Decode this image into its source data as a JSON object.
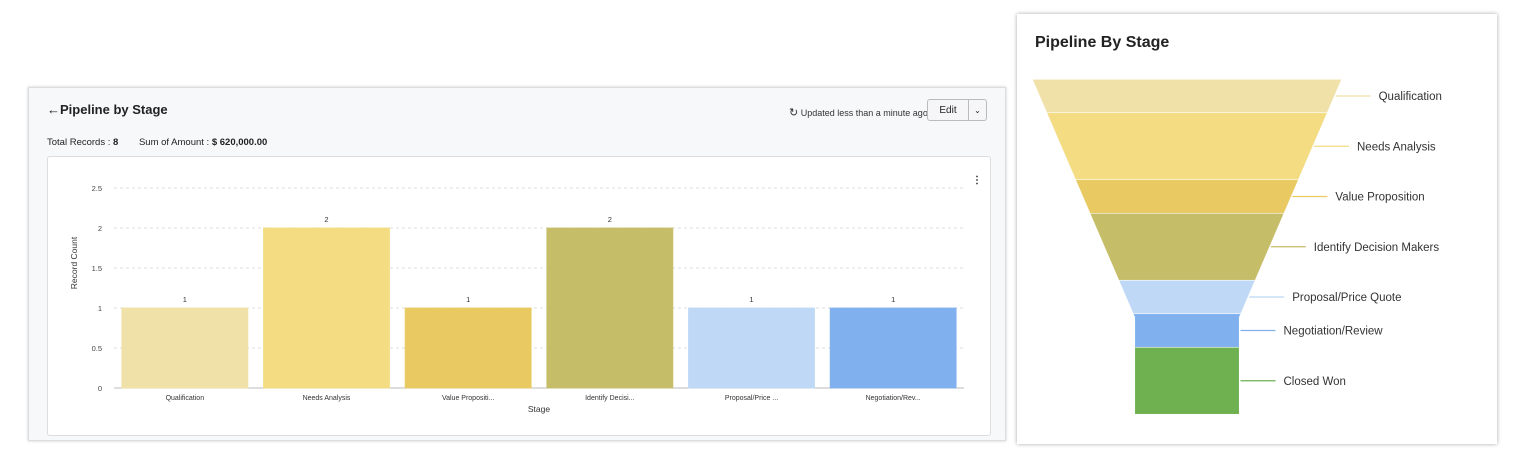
{
  "report": {
    "back_icon": "arrow-left-icon",
    "title": "Pipeline by Stage",
    "total_records_label": "Total Records :",
    "total_records": "8",
    "sum_label": "Sum of Amount :",
    "sum_value": "$ 620,000.00",
    "updated": "Updated less than a minute ago",
    "edit": "Edit",
    "more_icon": "more-vertical-icon"
  },
  "chart_data": [
    {
      "type": "bar",
      "title": "",
      "xlabel": "Stage",
      "ylabel": "Record Count",
      "ylim": [
        0,
        2.5
      ],
      "yticks": [
        "0",
        "0.5",
        "1",
        "1.5",
        "2",
        "2.5"
      ],
      "grid": true,
      "categories": [
        "Qualification",
        "Needs Analysis",
        "Value Propositi...",
        "Identify Decisi...",
        "Proposal/Price ...",
        "Negotiation/Rev..."
      ],
      "values": [
        1,
        2,
        1,
        2,
        1,
        1
      ],
      "colors": [
        "#f0e1a8",
        "#f3dc82",
        "#e8c962",
        "#c6bd68",
        "#bed8f5",
        "#80b1ee"
      ]
    },
    {
      "type": "funnel",
      "title": "Pipeline By Stage",
      "categories": [
        "Qualification",
        "Needs Analysis",
        "Value Proposition",
        "Identify Decision Makers",
        "Proposal/Price Quote",
        "Negotiation/Review",
        "Closed Won"
      ],
      "values": [
        1,
        2,
        1,
        2,
        1,
        1,
        2
      ],
      "colors": [
        "#f0e1a8",
        "#f3dc82",
        "#e8c962",
        "#c6bd68",
        "#bed8f5",
        "#80b1ee",
        "#6fb050"
      ]
    }
  ]
}
